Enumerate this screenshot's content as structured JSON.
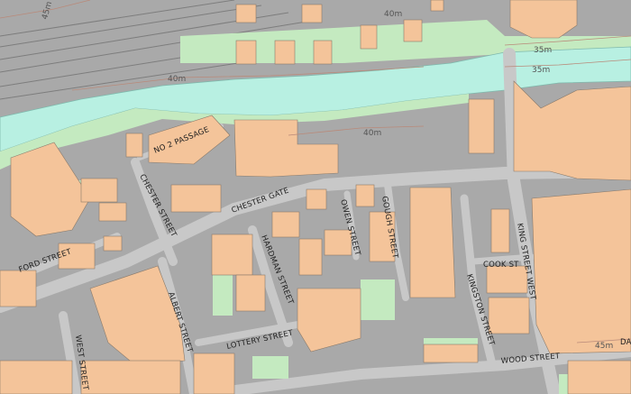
{
  "map": {
    "colors": {
      "background": "#a9a9a9",
      "road": "#c8c8c8",
      "building": "#f4c49a",
      "green": "#c4eac0",
      "water": "#b8f0e2",
      "railway": "#9a9a9a",
      "contour": "#b98a7a"
    },
    "streets": {
      "no2_passage": "NO 2 PASSAGE",
      "chester_gate": "CHESTER GATE",
      "chester_street": "CHESTER STREET",
      "ford_street": "FORD STREET",
      "hardman_street": "HARDMAN STREET",
      "owen_street": "OWEN STREET",
      "gough_street": "GOUGH STREET",
      "king_street_west": "KING STREET WEST",
      "cook_st": "COOK ST",
      "kingston_street": "KINGSTON STREET",
      "albert_street": "ALBERT STREET",
      "lottery_street": "LOTTERY STREET",
      "west_street": "WEST STREET",
      "wood_street": "WOOD STREET",
      "edge_da": "DA"
    },
    "contours": {
      "c45_top_left": "45m",
      "c40_top": "40m",
      "c35_a": "35m",
      "c35_b": "35m",
      "c40_left": "40m",
      "c40_mid": "40m",
      "c45_bottom_right": "45m"
    }
  }
}
